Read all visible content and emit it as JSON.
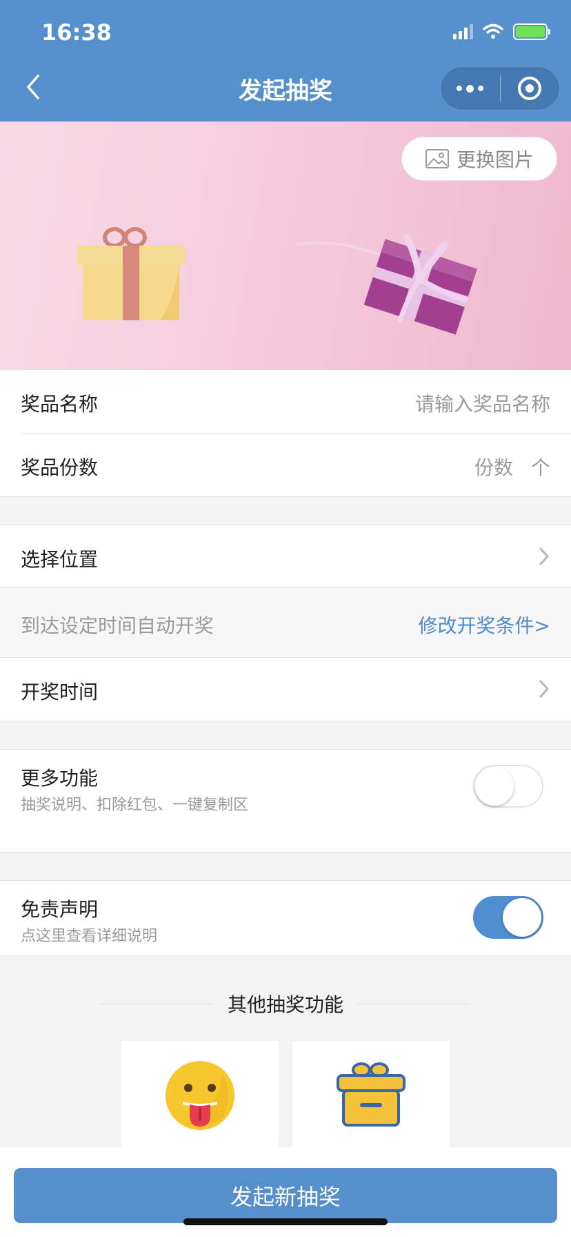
{
  "status": {
    "time": "16:38"
  },
  "nav": {
    "title": "发起抽奖"
  },
  "banner": {
    "change_image_label": "更换图片"
  },
  "prize": {
    "name_label": "奖品名称",
    "name_placeholder": "请输入奖品名称",
    "count_label": "奖品份数",
    "count_placeholder": "份数",
    "count_unit": "个"
  },
  "location": {
    "label": "选择位置"
  },
  "draw_condition": {
    "text": "到达设定时间自动开奖",
    "modify_link": "修改开奖条件>"
  },
  "draw_time": {
    "label": "开奖时间"
  },
  "more_features": {
    "label": "更多功能",
    "sublabel": "抽奖说明、扣除红包、一键复制区",
    "enabled": false
  },
  "disclaimer": {
    "label": "免责声明",
    "sublabel": "点这里查看详细说明",
    "enabled": true
  },
  "other_section": {
    "title": "其他抽奖功能"
  },
  "cards": [
    {
      "icon": "tongue-emoji-icon"
    },
    {
      "icon": "gift-box-icon"
    }
  ],
  "primary_action": {
    "label": "发起新抽奖"
  },
  "colors": {
    "primary": "#5590cc",
    "link": "#4c8ac8",
    "toggle_on": "#4f8ecf"
  }
}
